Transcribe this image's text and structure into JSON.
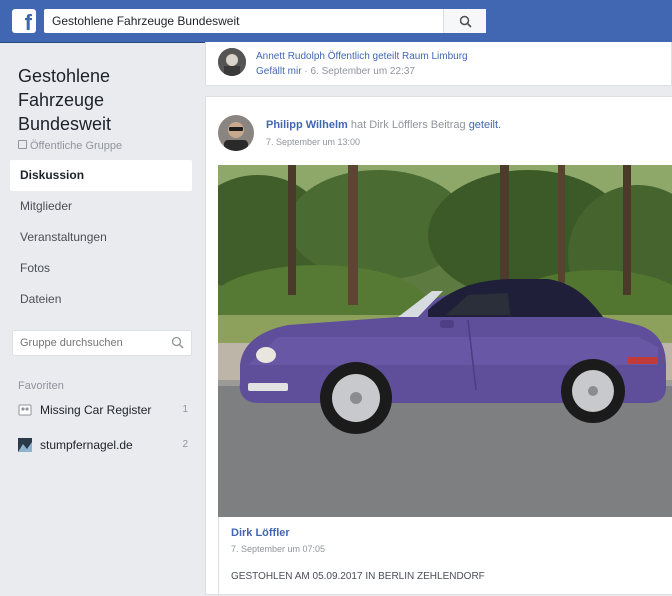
{
  "header": {
    "search_value": "Gestohlene Fahrzeuge Bundesweit",
    "logo": "f",
    "brand_color": "#4267b2"
  },
  "group": {
    "title": "Gestohlene Fahrzeuge Bundesweit",
    "type": "Öffentliche Gruppe"
  },
  "nav": {
    "items": [
      {
        "label": "Diskussion",
        "active": true
      },
      {
        "label": "Mitglieder"
      },
      {
        "label": "Veranstaltungen"
      },
      {
        "label": "Fotos"
      },
      {
        "label": "Dateien"
      }
    ]
  },
  "group_search": {
    "placeholder": "Gruppe durchsuchen"
  },
  "favorites": {
    "heading": "Favoriten",
    "items": [
      {
        "label": "Missing Car Register",
        "count": "1",
        "icon": "group-icon"
      },
      {
        "label": "stumpfernagel.de",
        "count": "2",
        "icon": "page-thumbnail-icon"
      }
    ]
  },
  "previous_story": {
    "text": "Annett Rudolph Öffentlich geteilt Raum Limburg",
    "like": "Gefällt mir",
    "time": "6. September um 22:37"
  },
  "post": {
    "author": "Philipp Wilhelm",
    "verb": "hat",
    "source": "Dirk Löfflers",
    "object": "Beitrag",
    "action": "geteilt.",
    "time": "7. September um 13:00"
  },
  "shared": {
    "author": "Dirk Löffler",
    "time": "7. September um 07:05",
    "text": "GESTOHLEN AM 05.09.2017 IN BERLIN ZEHLENDORF"
  }
}
